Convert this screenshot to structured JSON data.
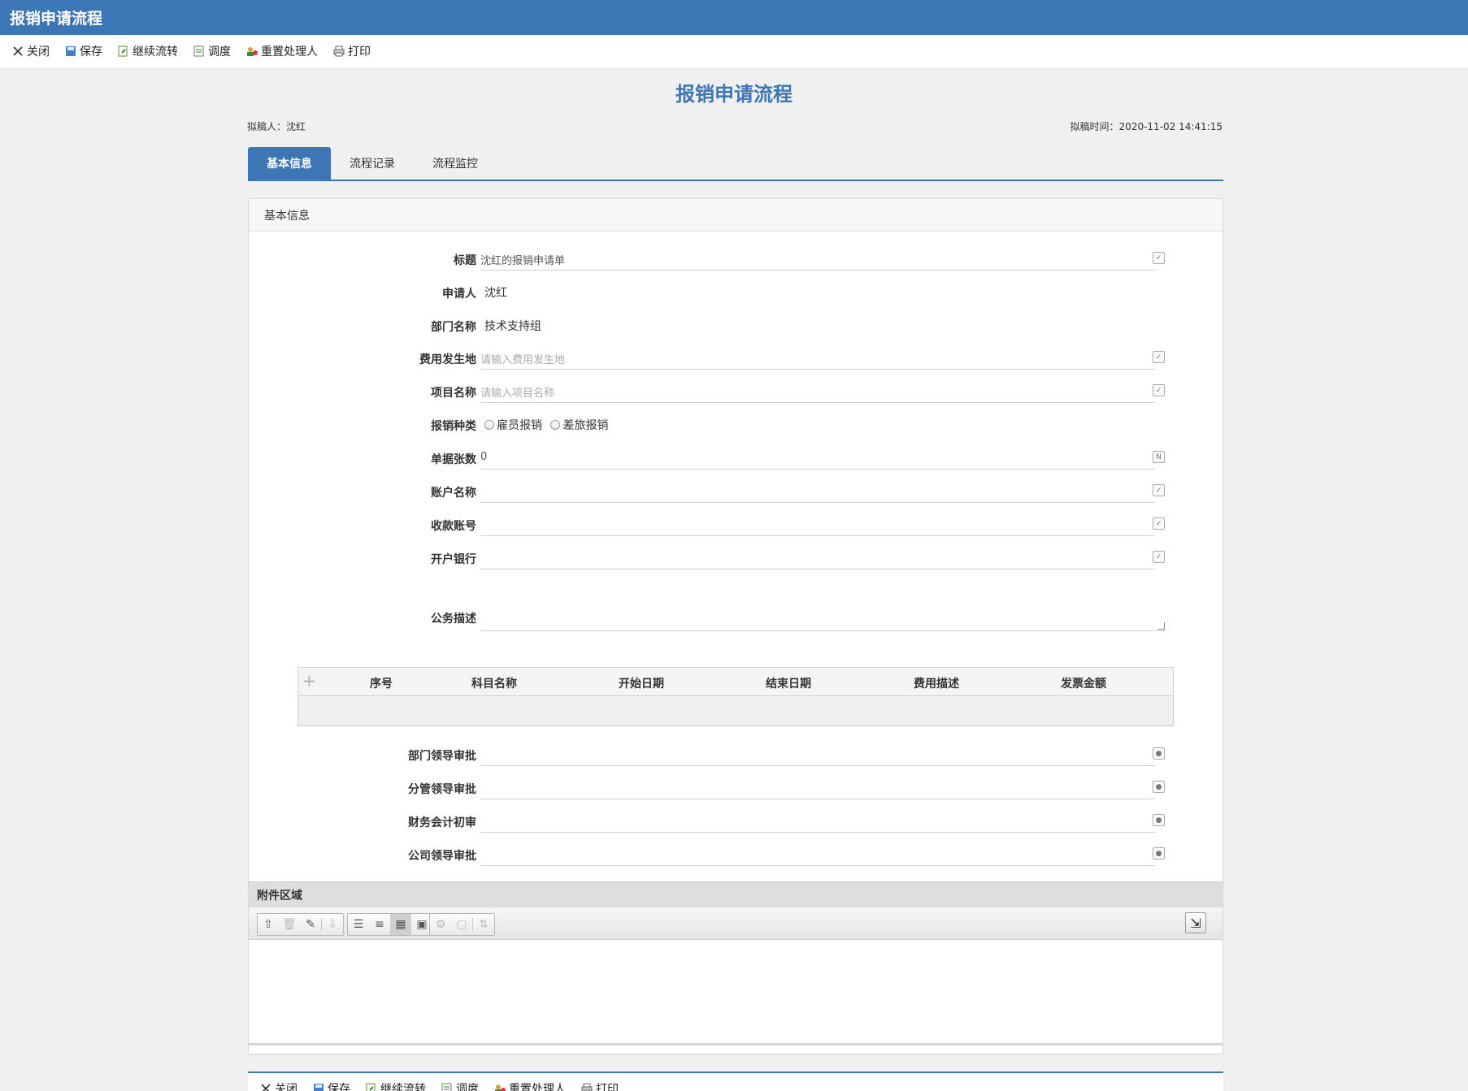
{
  "window": {
    "title": "报销申请流程"
  },
  "toolbar": {
    "items": [
      {
        "label": "关闭",
        "icon": "close-icon"
      },
      {
        "label": "保存",
        "icon": "save-icon"
      },
      {
        "label": "继续流转",
        "icon": "forward-icon"
      },
      {
        "label": "调度",
        "icon": "dispatch-icon"
      },
      {
        "label": "重置处理人",
        "icon": "reset-handler-icon"
      },
      {
        "label": "打印",
        "icon": "print-icon"
      }
    ]
  },
  "page": {
    "title": "报销申请流程",
    "drafter": "拟稿人：沈红",
    "draft_time": "拟稿时间：2020-11-02 14:41:15"
  },
  "tabs": [
    {
      "label": "基本信息",
      "active": true
    },
    {
      "label": "流程记录",
      "active": false
    },
    {
      "label": "流程监控",
      "active": false
    }
  ],
  "panel": {
    "header": "基本信息"
  },
  "form": {
    "title": {
      "label": "标题",
      "value": "沈红的报销申请单"
    },
    "applicant": {
      "label": "申请人",
      "value": "沈红"
    },
    "department": {
      "label": "部门名称",
      "value": "技术支持组"
    },
    "expense_location": {
      "label": "费用发生地",
      "placeholder": "请输入费用发生地"
    },
    "project_name": {
      "label": "项目名称",
      "placeholder": "请输入项目名称"
    },
    "reimburse_type": {
      "label": "报销种类",
      "options": [
        "雇员报销",
        "差旅报销"
      ]
    },
    "receipt_count": {
      "label": "单据张数",
      "value": "0"
    },
    "account_name": {
      "label": "账户名称",
      "value": ""
    },
    "account_number": {
      "label": "收款账号",
      "value": ""
    },
    "bank": {
      "label": "开户银行",
      "value": ""
    },
    "description": {
      "label": "公务描述",
      "value": ""
    },
    "dept_leader": {
      "label": "部门领导审批",
      "value": ""
    },
    "branch_leader": {
      "label": "分管领导审批",
      "value": ""
    },
    "finance_review": {
      "label": "财务会计初审",
      "value": ""
    },
    "company_leader": {
      "label": "公司领导审批",
      "value": ""
    }
  },
  "grid": {
    "columns": [
      "序号",
      "科目名称",
      "开始日期",
      "结束日期",
      "费用描述",
      "发票金额"
    ],
    "rows": []
  },
  "attachments": {
    "header": "附件区域"
  }
}
